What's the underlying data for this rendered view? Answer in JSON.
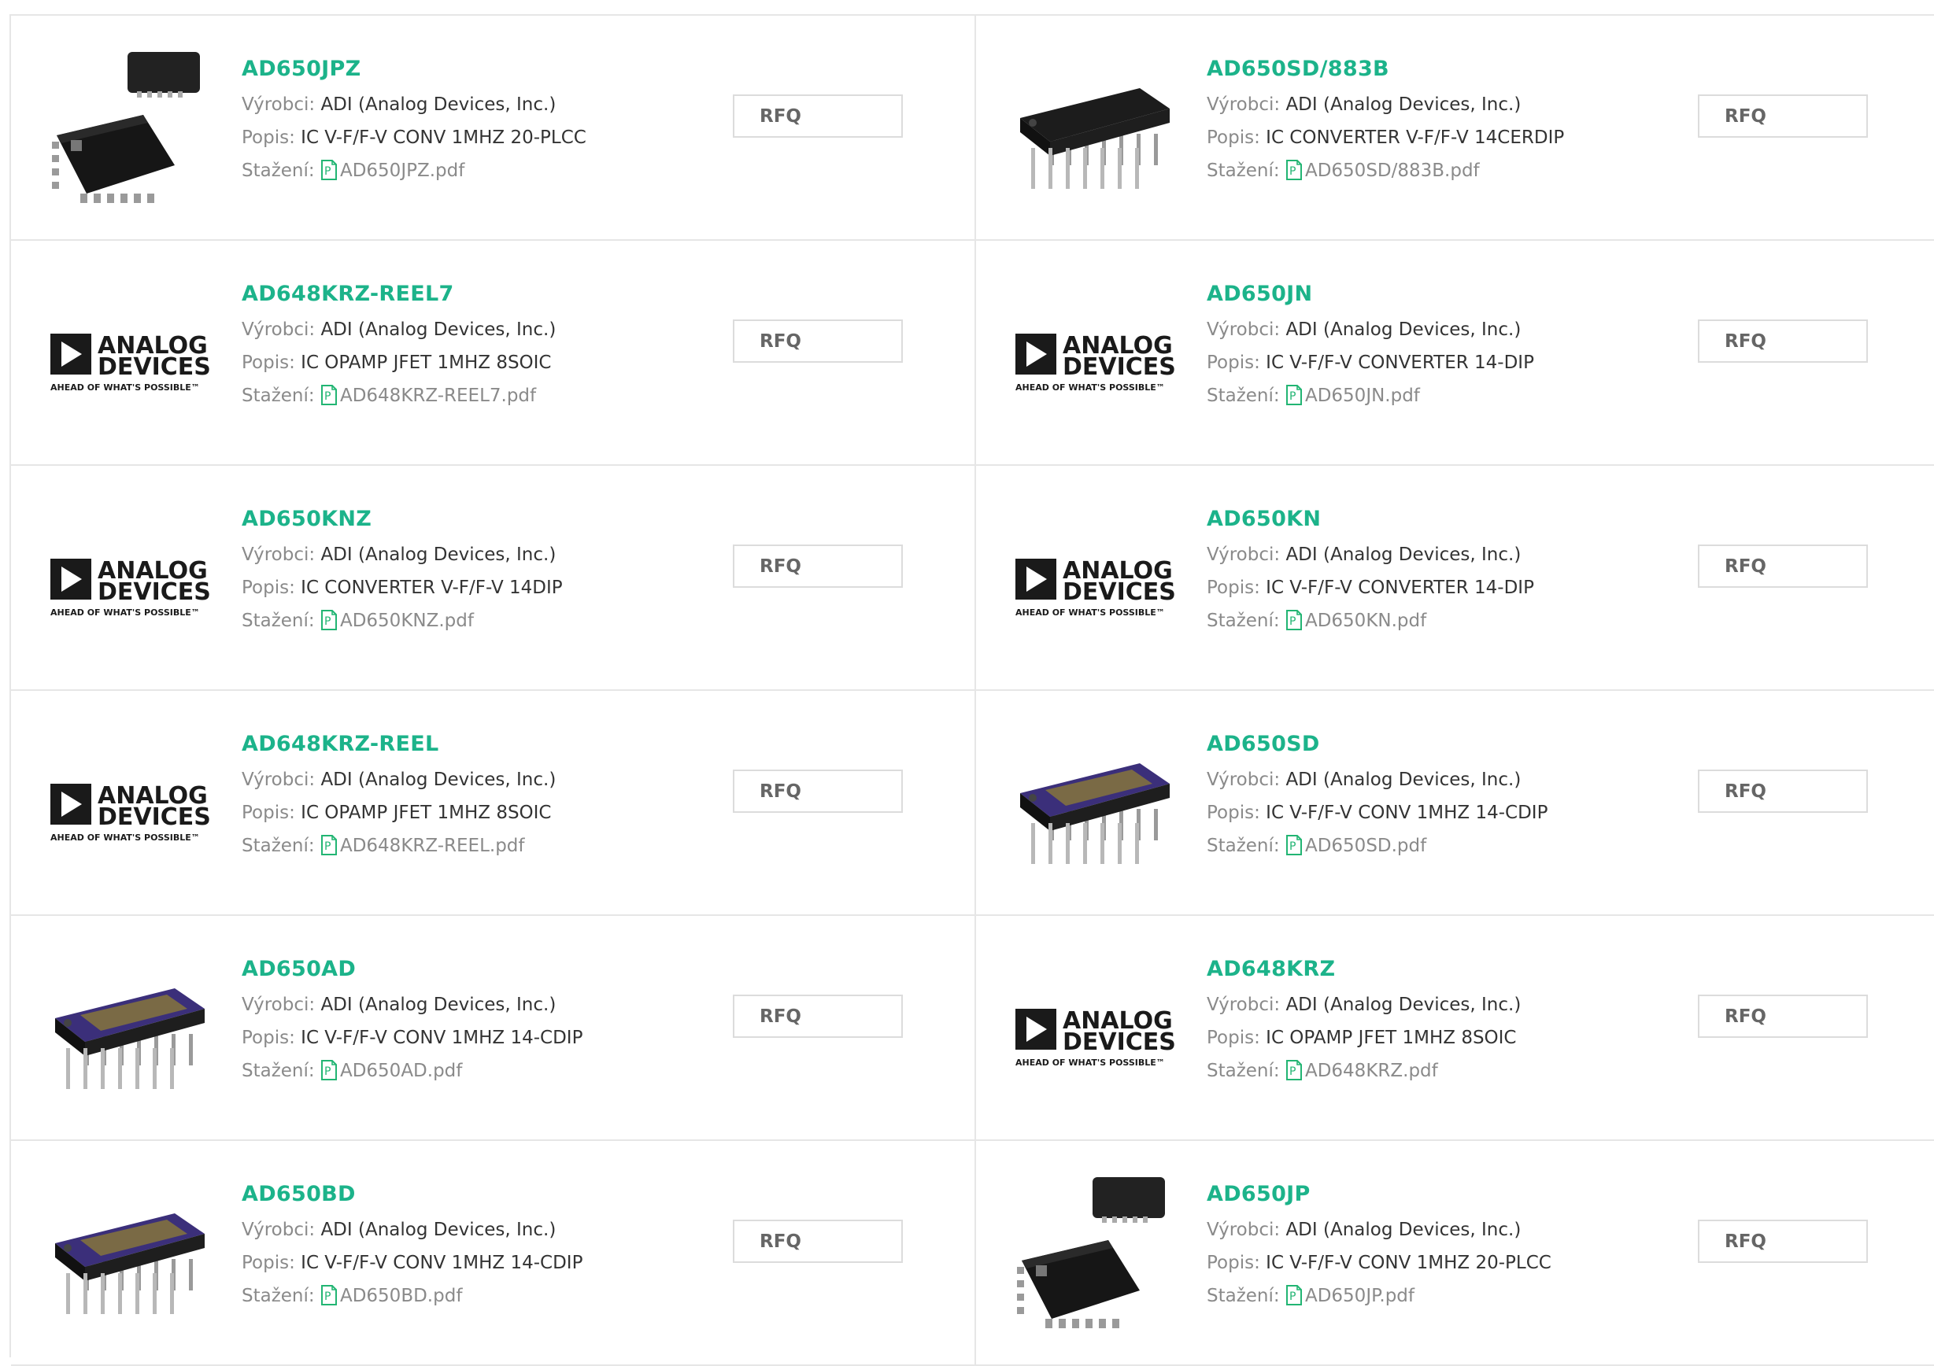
{
  "labels": {
    "manufacturer": "Výrobci:",
    "description": "Popis:",
    "download": "Stažení:",
    "rfq": "RFQ"
  },
  "colors": {
    "part_number": "#1cb38a",
    "label": "#8a8a8a",
    "border": "#e6e6e6"
  },
  "products": [
    {
      "part": "AD650JPZ",
      "manufacturer": "ADI (Analog Devices, Inc.)",
      "description": "IC V-F/F-V CONV 1MHZ 20-PLCC",
      "pdf": "AD650JPZ.pdf",
      "image": "plcc-chip"
    },
    {
      "part": "AD650SD/883B",
      "manufacturer": "ADI (Analog Devices, Inc.)",
      "description": "IC CONVERTER V-F/F-V 14CERDIP",
      "pdf": "AD650SD/883B.pdf",
      "image": "dip-chip-black"
    },
    {
      "part": "AD648KRZ-REEL7",
      "manufacturer": "ADI (Analog Devices, Inc.)",
      "description": "IC OPAMP JFET 1MHZ 8SOIC",
      "pdf": "AD648KRZ-REEL7.pdf",
      "image": "analog-devices-logo"
    },
    {
      "part": "AD650JN",
      "manufacturer": "ADI (Analog Devices, Inc.)",
      "description": "IC V-F/F-V CONVERTER 14-DIP",
      "pdf": "AD650JN.pdf",
      "image": "analog-devices-logo"
    },
    {
      "part": "AD650KNZ",
      "manufacturer": "ADI (Analog Devices, Inc.)",
      "description": "IC CONVERTER V-F/F-V 14DIP",
      "pdf": "AD650KNZ.pdf",
      "image": "analog-devices-logo"
    },
    {
      "part": "AD650KN",
      "manufacturer": "ADI (Analog Devices, Inc.)",
      "description": "IC V-F/F-V CONVERTER 14-DIP",
      "pdf": "AD650KN.pdf",
      "image": "analog-devices-logo"
    },
    {
      "part": "AD648KRZ-REEL",
      "manufacturer": "ADI (Analog Devices, Inc.)",
      "description": "IC OPAMP JFET 1MHZ 8SOIC",
      "pdf": "AD648KRZ-REEL.pdf",
      "image": "analog-devices-logo"
    },
    {
      "part": "AD650SD",
      "manufacturer": "ADI (Analog Devices, Inc.)",
      "description": "IC V-F/F-V CONV 1MHZ 14-CDIP",
      "pdf": "AD650SD.pdf",
      "image": "cdip-chip-purple"
    },
    {
      "part": "AD650AD",
      "manufacturer": "ADI (Analog Devices, Inc.)",
      "description": "IC V-F/F-V CONV 1MHZ 14-CDIP",
      "pdf": "AD650AD.pdf",
      "image": "cdip-chip-purple"
    },
    {
      "part": "AD648KRZ",
      "manufacturer": "ADI (Analog Devices, Inc.)",
      "description": "IC OPAMP JFET 1MHZ 8SOIC",
      "pdf": "AD648KRZ.pdf",
      "image": "analog-devices-logo"
    },
    {
      "part": "AD650BD",
      "manufacturer": "ADI (Analog Devices, Inc.)",
      "description": "IC V-F/F-V CONV 1MHZ 14-CDIP",
      "pdf": "AD650BD.pdf",
      "image": "cdip-chip-purple"
    },
    {
      "part": "AD650JP",
      "manufacturer": "ADI (Analog Devices, Inc.)",
      "description": "IC V-F/F-V CONV 1MHZ 20-PLCC",
      "pdf": "AD650JP.pdf",
      "image": "plcc-chip"
    }
  ],
  "logo": {
    "line1": "ANALOG",
    "line2": "DEVICES",
    "tagline": "AHEAD OF WHAT'S POSSIBLE™"
  }
}
